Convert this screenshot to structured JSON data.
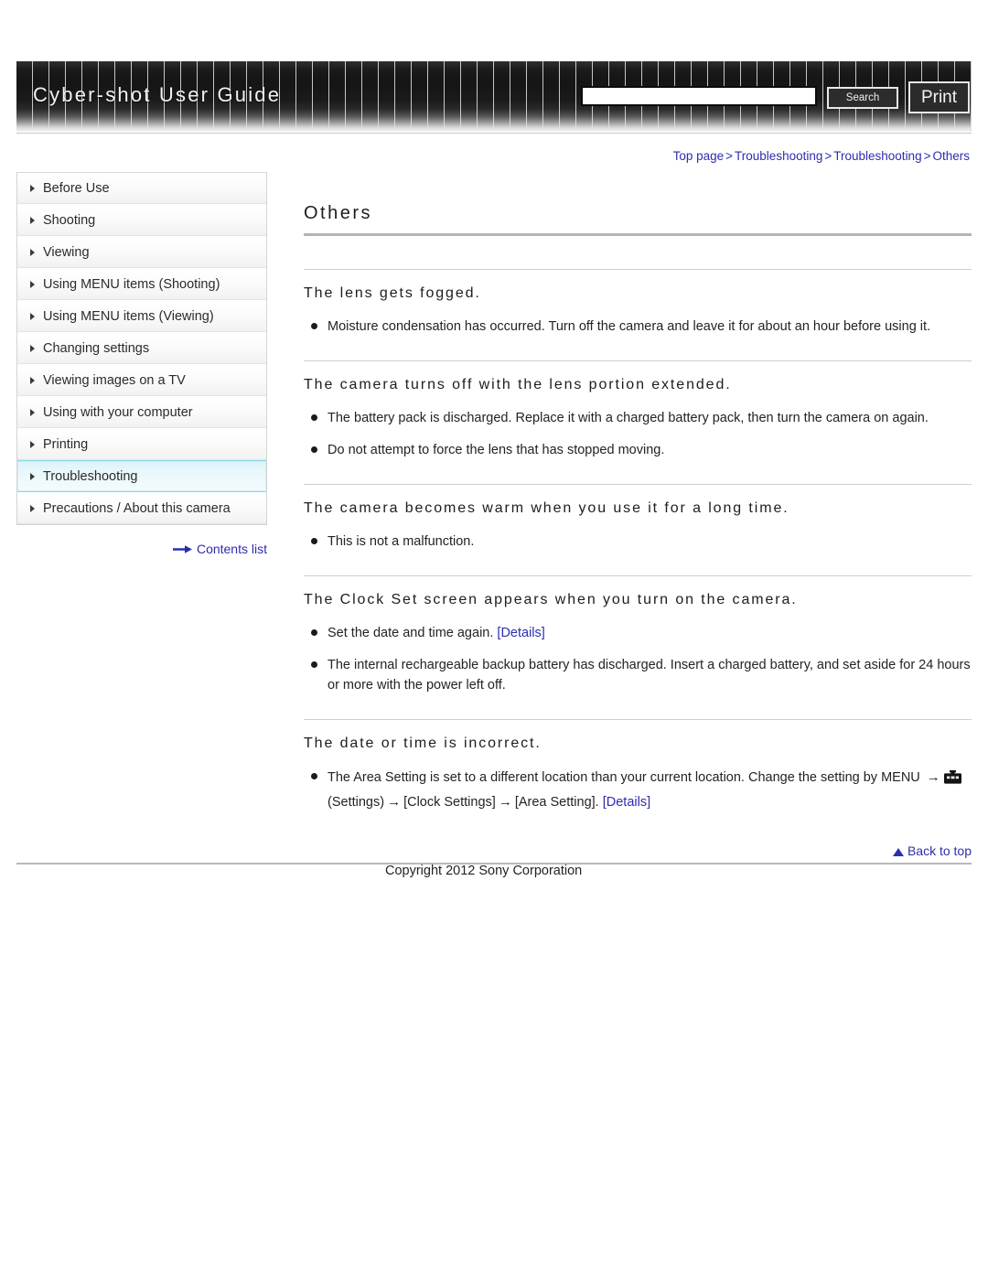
{
  "header": {
    "site_title": "Cyber-shot User Guide",
    "search_value": "",
    "search_placeholder": "",
    "search_button": "Search",
    "print_button": "Print"
  },
  "breadcrumb": {
    "items": [
      "Top page",
      "Troubleshooting",
      "Troubleshooting",
      "Others"
    ],
    "separator": ">"
  },
  "sidebar": {
    "items": [
      {
        "label": "Before Use",
        "active": false
      },
      {
        "label": "Shooting",
        "active": false
      },
      {
        "label": "Viewing",
        "active": false
      },
      {
        "label": "Using MENU items (Shooting)",
        "active": false
      },
      {
        "label": "Using MENU items (Viewing)",
        "active": false
      },
      {
        "label": "Changing settings",
        "active": false
      },
      {
        "label": "Viewing images on a TV",
        "active": false
      },
      {
        "label": "Using with your computer",
        "active": false
      },
      {
        "label": "Printing",
        "active": false
      },
      {
        "label": "Troubleshooting",
        "active": true
      },
      {
        "label": "Precautions / About this camera",
        "active": false
      }
    ],
    "contents_link": "Contents list",
    "contents_icon": "right-arrow-icon"
  },
  "main": {
    "page_title": "Others",
    "sections": [
      {
        "heading": "The lens gets fogged.",
        "bullets": [
          {
            "text": "Moisture condensation has occurred. Turn off the camera and leave it for about an hour before using it."
          }
        ]
      },
      {
        "heading": "The camera turns off with the lens portion extended.",
        "bullets": [
          {
            "text": "The battery pack is discharged. Replace it with a charged battery pack, then turn the camera on again."
          },
          {
            "text": "Do not attempt to force the lens that has stopped moving."
          }
        ]
      },
      {
        "heading": "The camera becomes warm when you use it for a long time.",
        "bullets": [
          {
            "text": "This is not a malfunction."
          }
        ]
      },
      {
        "heading": "The Clock Set screen appears when you turn on the camera.",
        "bullets": [
          {
            "text": "Set the date and time again.",
            "link": "[Details]"
          },
          {
            "text": "The internal rechargeable backup battery has discharged. Insert a charged battery, and set aside for 24 hours or more with the power left off."
          }
        ]
      },
      {
        "heading": "The date or time is incorrect.",
        "bullets": [
          {
            "text_before": "The Area Setting is set to a different location than your current location. Change the setting by MENU",
            "arrow": "→",
            "icon": "toolbox-settings-icon",
            "text_mid_1": "(Settings)",
            "text_mid_2": "[Clock Settings]",
            "text_mid_3": "[Area Setting].",
            "link": "[Details]"
          }
        ]
      }
    ]
  },
  "footer": {
    "back_to_top": "Back to top",
    "back_to_top_icon": "triangle-up-icon",
    "copyright": "Copyright 2012 Sony Corporation"
  }
}
